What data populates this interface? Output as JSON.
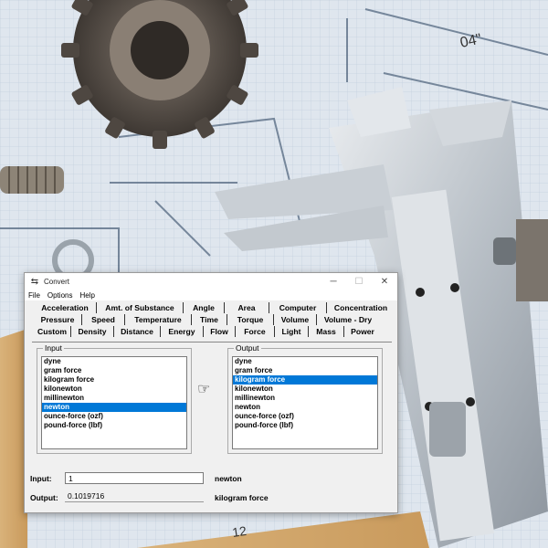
{
  "window": {
    "title": "Convert",
    "menu": [
      "File",
      "Options",
      "Help"
    ]
  },
  "tabs": {
    "row1": [
      "Acceleration",
      "Amt. of Substance",
      "Angle",
      "Area",
      "Computer",
      "Concentration"
    ],
    "row2": [
      "Pressure",
      "Speed",
      "Temperature",
      "Time",
      "Torque",
      "Volume",
      "Volume - Dry"
    ],
    "row3": [
      "Custom",
      "Density",
      "Distance",
      "Energy",
      "Flow",
      "Force",
      "Light",
      "Mass",
      "Power"
    ],
    "active": "Force"
  },
  "input_group": {
    "label": "Input",
    "items": [
      "dyne",
      "gram force",
      "kilogram force",
      "kilonewton",
      "millinewton",
      "newton",
      "ounce-force (ozf)",
      "pound-force (lbf)"
    ],
    "selected": "newton"
  },
  "output_group": {
    "label": "Output",
    "items": [
      "dyne",
      "gram force",
      "kilogram force",
      "kilonewton",
      "millinewton",
      "newton",
      "ounce-force (ozf)",
      "pound-force (lbf)"
    ],
    "selected": "kilogram force"
  },
  "io": {
    "input_label": "Input:",
    "input_value": "1",
    "input_unit": "newton",
    "output_label": "Output:",
    "output_value": "0.1019716",
    "output_unit": "kilogram force"
  },
  "background": {
    "drawing_label": "04\""
  },
  "colors": {
    "selection": "#0078d7",
    "paper": "#dfe6ee",
    "grid": "#9fb3c8"
  }
}
